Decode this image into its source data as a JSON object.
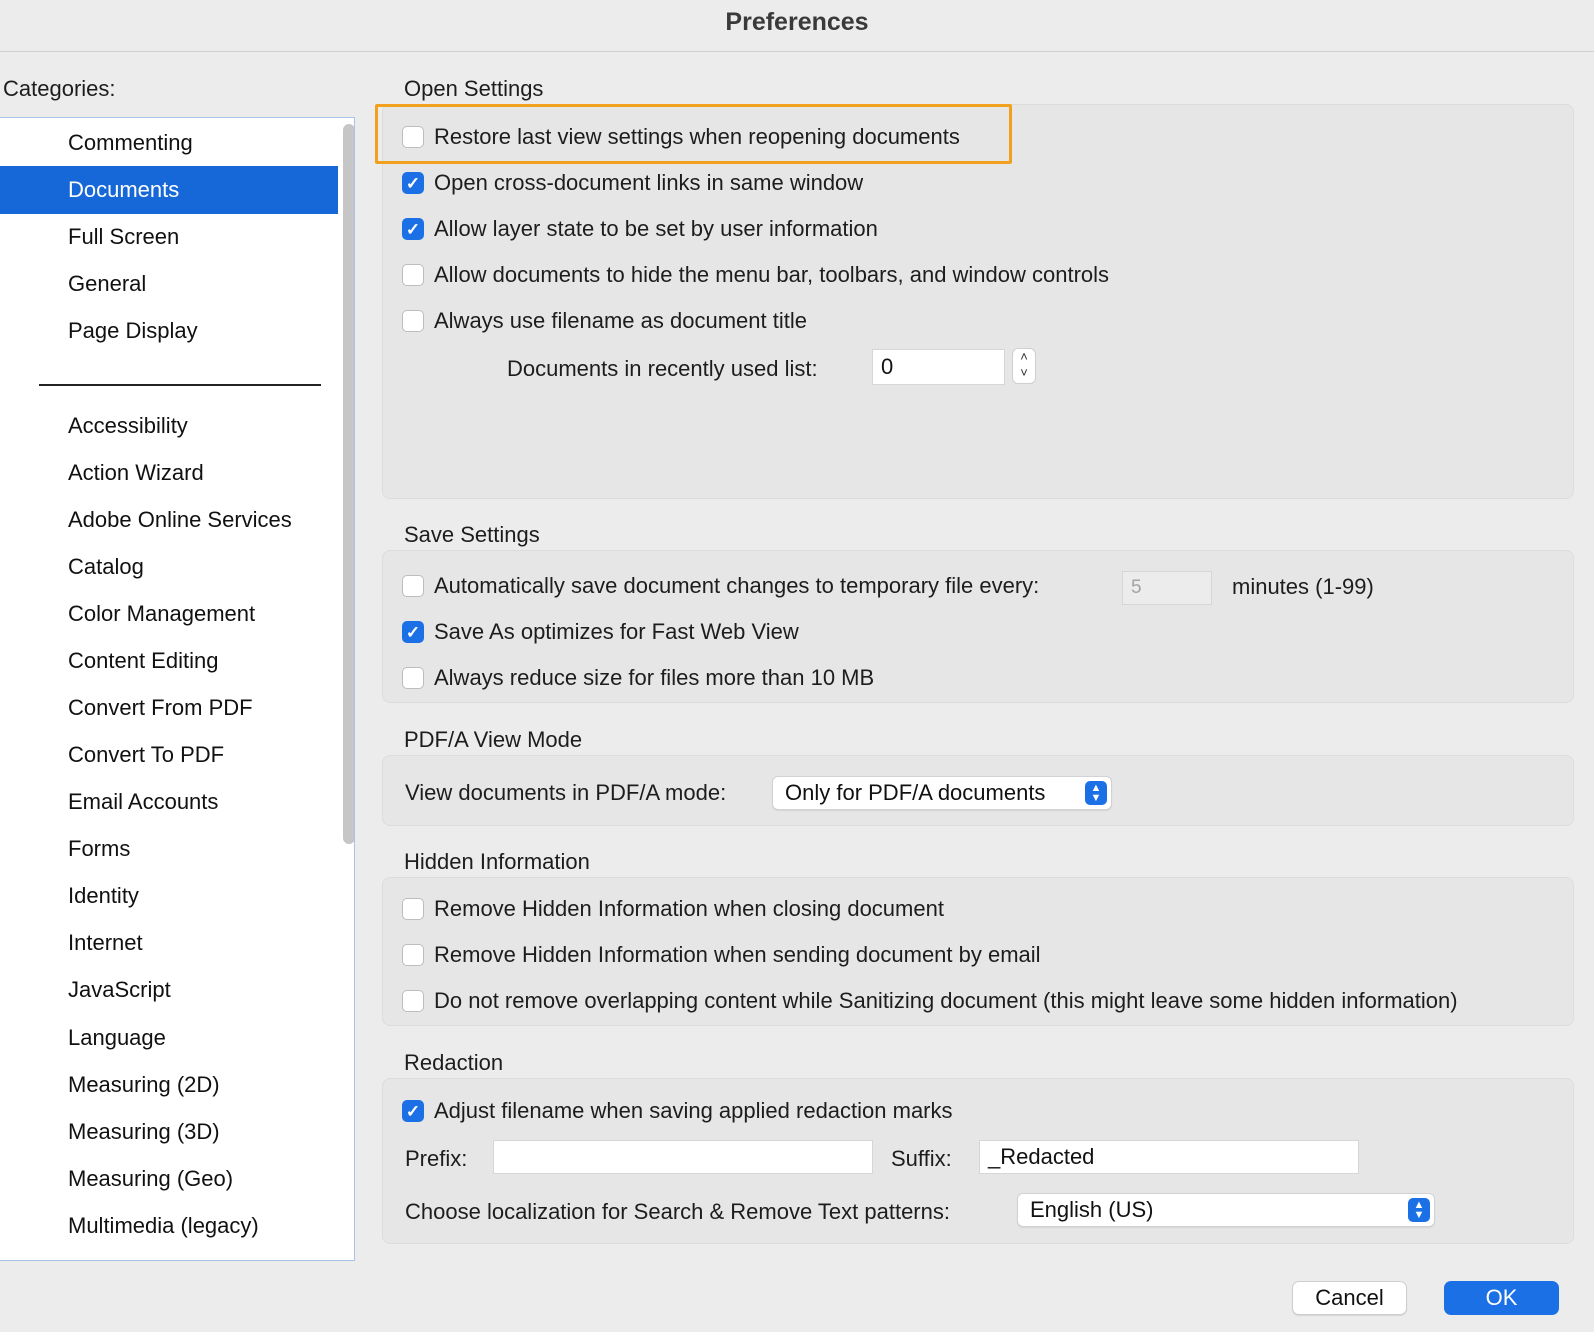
{
  "window": {
    "title": "Preferences"
  },
  "categories": {
    "label": "Categories:",
    "primary": [
      {
        "label": "Commenting",
        "selected": false
      },
      {
        "label": "Documents",
        "selected": true
      },
      {
        "label": "Full Screen",
        "selected": false
      },
      {
        "label": "General",
        "selected": false
      },
      {
        "label": "Page Display",
        "selected": false
      }
    ],
    "secondary": [
      "Accessibility",
      "Action Wizard",
      "Adobe Online Services",
      "Catalog",
      "Color Management",
      "Content Editing",
      "Convert From PDF",
      "Convert To PDF",
      "Email Accounts",
      "Forms",
      "Identity",
      "Internet",
      "JavaScript",
      "Language",
      "Measuring (2D)",
      "Measuring (3D)",
      "Measuring (Geo)",
      "Multimedia (legacy)"
    ]
  },
  "open_settings": {
    "title": "Open Settings",
    "options": [
      {
        "label": "Restore last view settings when reopening documents",
        "checked": false
      },
      {
        "label": "Open cross-document links in same window",
        "checked": true
      },
      {
        "label": "Allow layer state to be set by user information",
        "checked": true
      },
      {
        "label": "Allow documents to hide the menu bar, toolbars, and window controls",
        "checked": false
      },
      {
        "label": "Always use filename as document title",
        "checked": false
      }
    ],
    "recent_label": "Documents in recently used list:",
    "recent_value": "0"
  },
  "save_settings": {
    "title": "Save Settings",
    "autosave_label": "Automatically save document changes to temporary file every:",
    "autosave_checked": false,
    "autosave_value": "5",
    "autosave_units": "minutes (1-99)",
    "fast_web_label": "Save As optimizes for Fast Web View",
    "fast_web_checked": true,
    "reduce_label": "Always reduce size for files more than 10 MB",
    "reduce_checked": false
  },
  "pdfa": {
    "title": "PDF/A View Mode",
    "label": "View documents in PDF/A mode:",
    "selected": "Only for PDF/A documents"
  },
  "hidden_info": {
    "title": "Hidden Information",
    "options": [
      {
        "label": "Remove Hidden Information when closing document",
        "checked": false
      },
      {
        "label": "Remove Hidden Information when sending document by email",
        "checked": false
      },
      {
        "label": "Do not remove overlapping content while Sanitizing document (this might leave some hidden information)",
        "checked": false
      }
    ]
  },
  "redaction": {
    "title": "Redaction",
    "adjust_label": "Adjust filename when saving applied redaction marks",
    "adjust_checked": true,
    "prefix_label": "Prefix:",
    "prefix_value": "",
    "suffix_label": "Suffix:",
    "suffix_value": "_Redacted",
    "localization_label": "Choose localization for Search & Remove Text patterns:",
    "localization_value": "English (US)"
  },
  "buttons": {
    "cancel": "Cancel",
    "ok": "OK"
  },
  "colors": {
    "accent": "#1c70e6",
    "selection": "#1667d8",
    "highlight": "#f2a11e"
  }
}
